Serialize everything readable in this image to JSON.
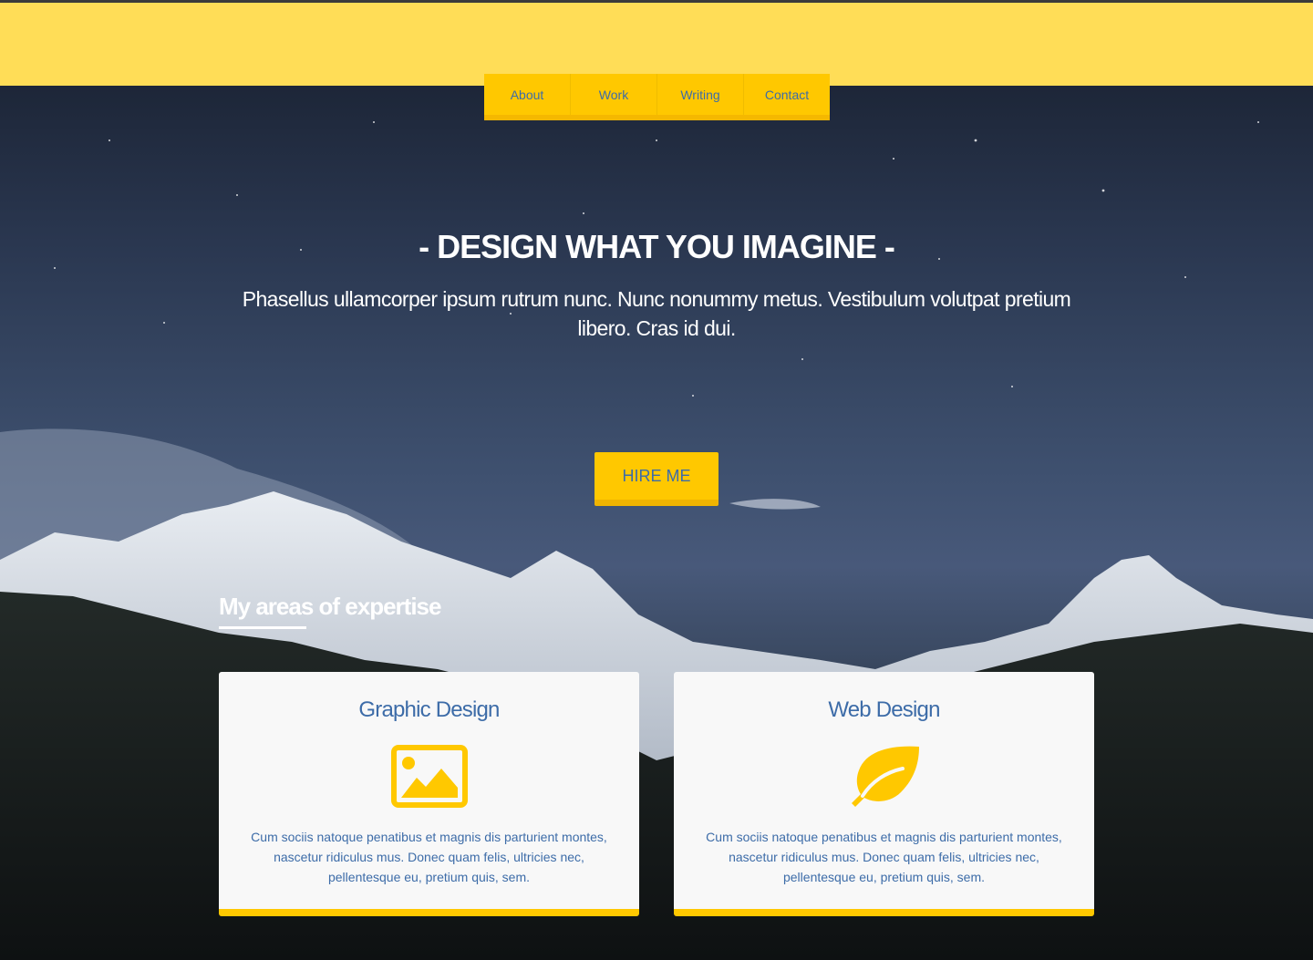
{
  "nav": {
    "items": [
      {
        "label": "About"
      },
      {
        "label": "Work"
      },
      {
        "label": "Writing"
      },
      {
        "label": "Contact"
      }
    ]
  },
  "hero": {
    "headline": "- DESIGN WHAT YOU IMAGINE -",
    "subtext": "Phasellus ullamcorper ipsum rutrum nunc. Nunc nonummy metus. Vestibulum volutpat pretium libero. Cras id dui.",
    "cta_label": "HIRE ME"
  },
  "expertise": {
    "title": "My areas of expertise",
    "cards": [
      {
        "title": "Graphic Design",
        "icon": "image-icon",
        "text": "Cum sociis natoque penatibus et magnis dis parturient montes, nascetur ridiculus mus. Donec quam felis, ultricies nec, pellentesque eu, pretium quis, sem."
      },
      {
        "title": "Web Design",
        "icon": "leaf-icon",
        "text": "Cum sociis natoque penatibus et magnis dis parturient montes, nascetur ridiculus mus. Donec quam felis, ultricies nec, pellentesque eu, pretium quis, sem."
      }
    ]
  },
  "colors": {
    "accent": "#ffc800",
    "topbar": "#ffdd57",
    "link_blue": "#3d6ca8",
    "card_bg": "#f8f8f8"
  }
}
